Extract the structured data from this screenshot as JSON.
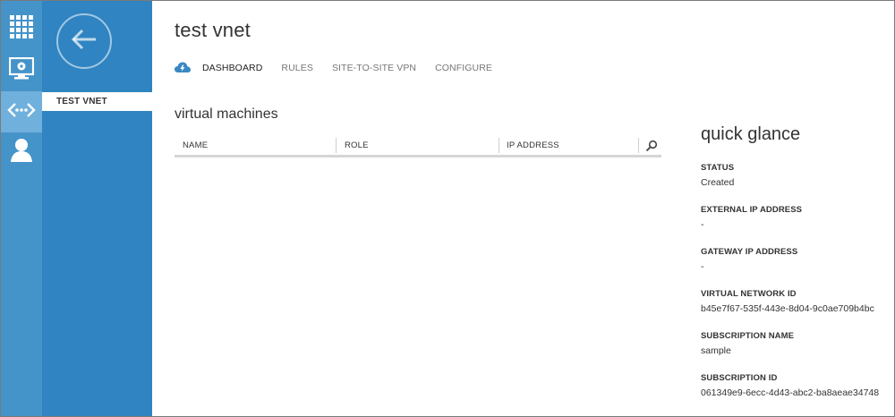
{
  "colors": {
    "rail": "#4594c9",
    "rail_active": "#6fb0dc",
    "blade": "#2f84c1",
    "accent_icon": "#3a87c3"
  },
  "rail": {
    "items": [
      {
        "icon": "all-items-grid-icon"
      },
      {
        "icon": "virtual-machines-icon"
      },
      {
        "icon": "networks-icon",
        "active": true
      },
      {
        "icon": "user-icon"
      }
    ]
  },
  "blade": {
    "back_icon": "back-arrow-icon",
    "items": [
      {
        "label": "TEST VNET"
      }
    ]
  },
  "main": {
    "title": "test vnet",
    "tabs": [
      {
        "label": "DASHBOARD",
        "active": true
      },
      {
        "label": "RULES"
      },
      {
        "label": "SITE-TO-SITE VPN"
      },
      {
        "label": "CONFIGURE"
      }
    ],
    "section_title": "virtual machines",
    "table": {
      "columns": [
        "NAME",
        "ROLE",
        "IP ADDRESS"
      ],
      "rows": []
    }
  },
  "quick_glance": {
    "title": "quick glance",
    "items": [
      {
        "label": "STATUS",
        "value": "Created"
      },
      {
        "label": "EXTERNAL IP ADDRESS",
        "value": "-"
      },
      {
        "label": "GATEWAY IP ADDRESS",
        "value": "-"
      },
      {
        "label": "VIRTUAL NETWORK ID",
        "value": "b45e7f67-535f-443e-8d04-9c0ae709b4bc"
      },
      {
        "label": "SUBSCRIPTION NAME",
        "value": "sample"
      },
      {
        "label": "SUBSCRIPTION ID",
        "value": "061349e9-6ecc-4d43-abc2-ba8aeae34748"
      }
    ]
  }
}
